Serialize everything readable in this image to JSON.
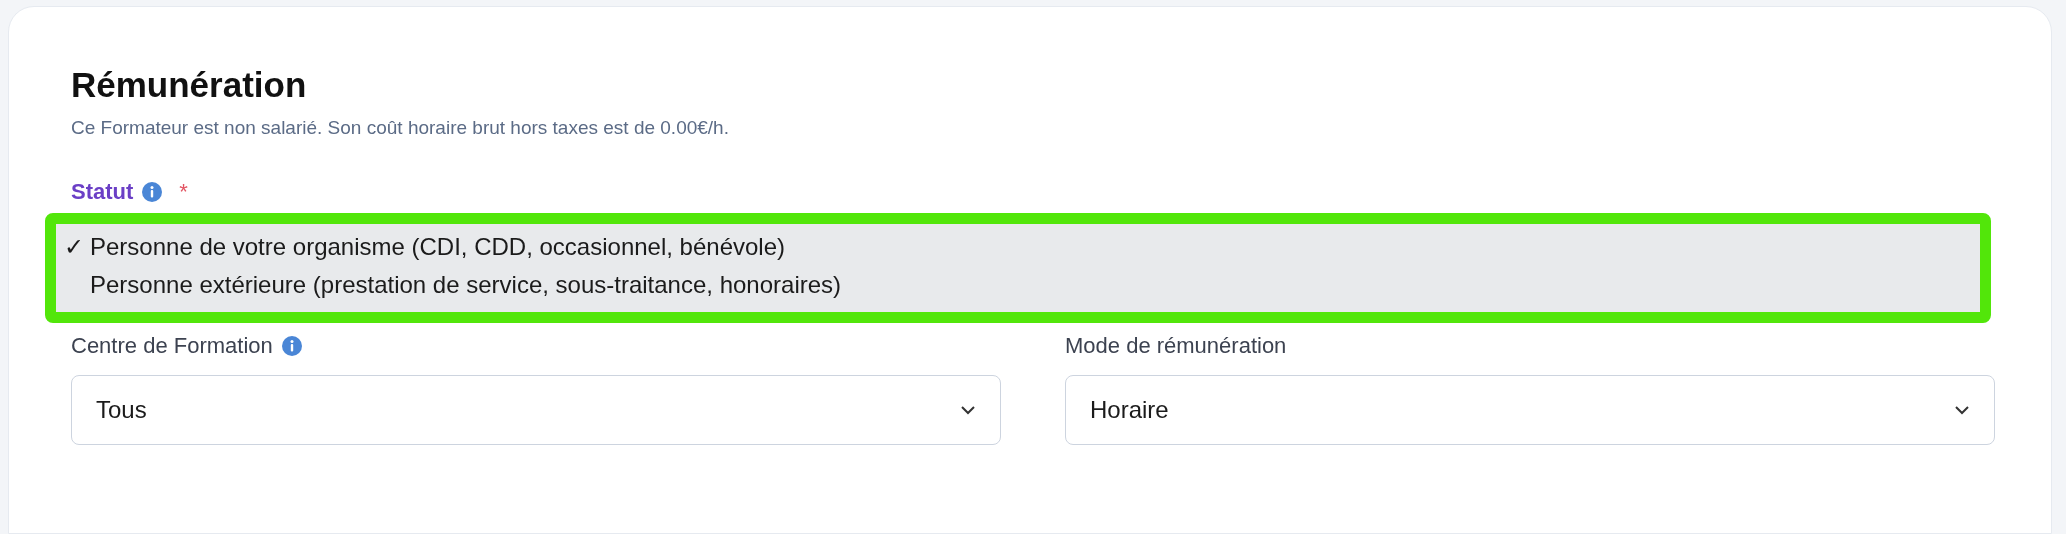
{
  "section": {
    "title": "Rémunération",
    "subtitle": "Ce Formateur est non salarié. Son coût horaire brut hors taxes est de 0.00€/h."
  },
  "status_field": {
    "label": "Statut",
    "required_mark": "*",
    "check_mark": "✓",
    "options": [
      {
        "label": "Personne de votre organisme (CDI, CDD, occasionnel, bénévole)",
        "selected": true
      },
      {
        "label": "Personne extérieure (prestation de service, sous-traitance, honoraires)",
        "selected": false
      }
    ]
  },
  "fields": [
    {
      "label": "Centre de Formation",
      "info": true,
      "value": "Tous"
    },
    {
      "label": "Mode de rémunération",
      "info": false,
      "value": "Horaire"
    }
  ]
}
